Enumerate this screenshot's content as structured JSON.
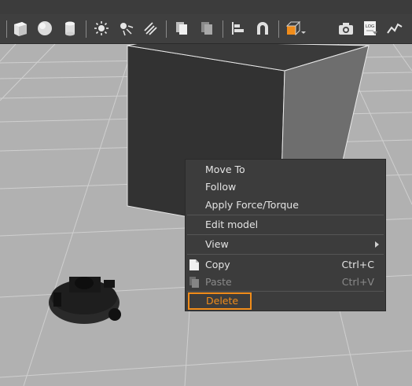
{
  "colors": {
    "toolbar_bg": "#3f3f3f",
    "menu_bg": "#3c3c3c",
    "highlight": "#f08c1a",
    "ground": "#b0b0b0"
  },
  "toolbar": {
    "tools": [
      {
        "icon": "box-shape-icon"
      },
      {
        "icon": "sphere-shape-icon"
      },
      {
        "icon": "cylinder-shape-icon"
      },
      {
        "icon": "point-light-icon"
      },
      {
        "icon": "spot-light-icon"
      },
      {
        "icon": "directional-light-icon"
      },
      {
        "icon": "copy-icon"
      },
      {
        "icon": "paste-icon"
      },
      {
        "icon": "align-icon"
      },
      {
        "icon": "magnet-snap-icon"
      },
      {
        "icon": "view-angle-cube-icon"
      },
      {
        "icon": "screenshot-camera-icon"
      },
      {
        "icon": "log-record-icon"
      },
      {
        "icon": "plot-icon"
      }
    ],
    "log_label": "LOG"
  },
  "context_menu": {
    "items": [
      {
        "label": "Move To"
      },
      {
        "label": "Follow"
      },
      {
        "label": "Apply Force/Torque"
      },
      {
        "label": "Edit model"
      },
      {
        "label": "View"
      },
      {
        "label": "Copy",
        "shortcut": "Ctrl+C"
      },
      {
        "label": "Paste",
        "shortcut": "Ctrl+V",
        "disabled": true
      },
      {
        "label": "Delete"
      }
    ]
  }
}
